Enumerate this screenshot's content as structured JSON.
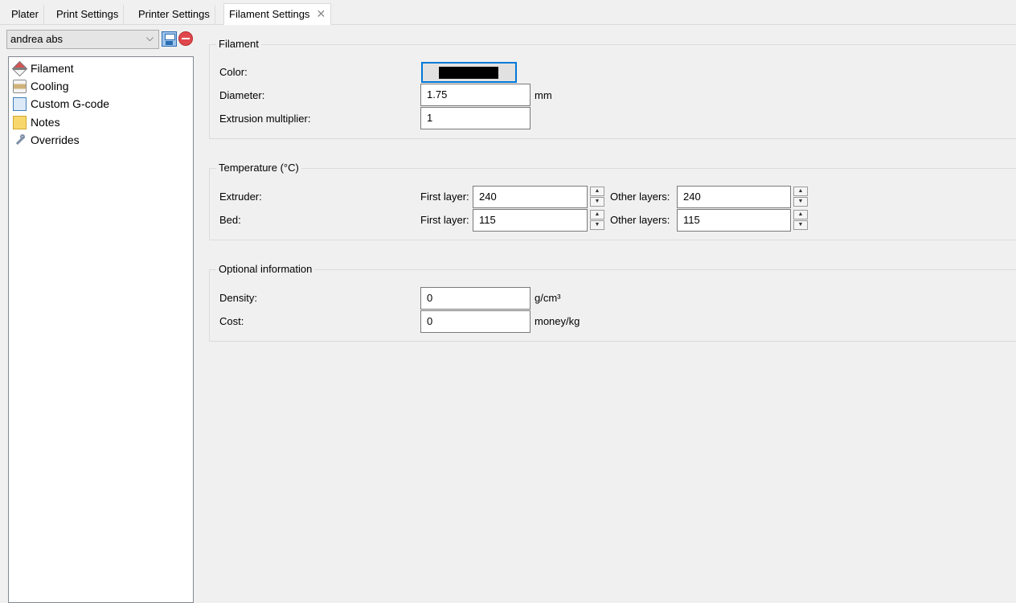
{
  "tabs": [
    {
      "label": "Plater"
    },
    {
      "label": "Print Settings"
    },
    {
      "label": "Printer Settings"
    },
    {
      "label": "Filament Settings",
      "close": "✕"
    }
  ],
  "preset": {
    "value": "andrea abs",
    "arrow": "⌵"
  },
  "tree": {
    "items": [
      {
        "label": "Filament",
        "icon": "filament-icon"
      },
      {
        "label": "Cooling",
        "icon": "hourglass-icon"
      },
      {
        "label": "Custom G-code",
        "icon": "scroll-icon"
      },
      {
        "label": "Notes",
        "icon": "note-icon"
      },
      {
        "label": "Overrides",
        "icon": "wrench-icon"
      }
    ]
  },
  "filament": {
    "title": "Filament",
    "color_label": "Color:",
    "color_value": "#000000",
    "diameter_label": "Diameter:",
    "diameter_value": "1.75",
    "diameter_unit": "mm",
    "extrusion_label": "Extrusion multiplier:",
    "extrusion_value": "1"
  },
  "temperature": {
    "title": "Temperature (°C)",
    "extruder_label": "Extruder:",
    "bed_label": "Bed:",
    "first_layer_label": "First layer:",
    "other_layers_label": "Other layers:",
    "extruder_first": "240",
    "extruder_other": "240",
    "bed_first": "115",
    "bed_other": "115"
  },
  "optional": {
    "title": "Optional information",
    "density_label": "Density:",
    "density_value": "0",
    "density_unit": "g/cm³",
    "cost_label": "Cost:",
    "cost_value": "0",
    "cost_unit": "money/kg"
  },
  "spin": {
    "up": "▲",
    "down": "▼"
  }
}
